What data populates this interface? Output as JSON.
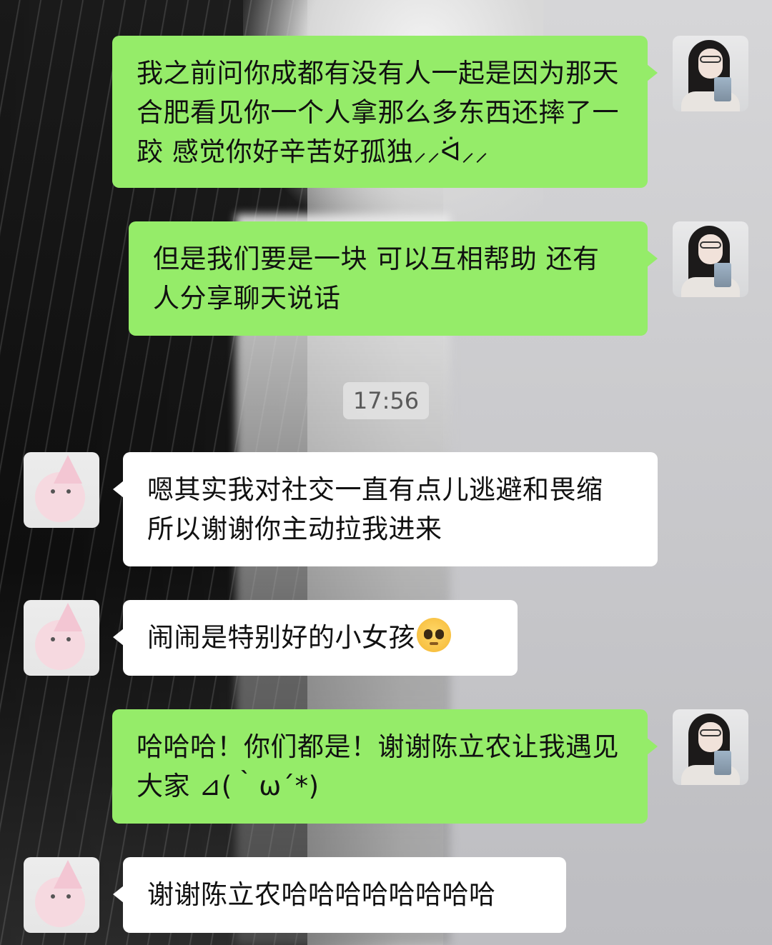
{
  "timestamp": "17:56",
  "messages": [
    {
      "sender": "me",
      "text": "我之前问你成都有没有人一起是因为那天合肥看见你一个人拿那么多东西还摔了一跤 感觉你好辛苦好孤独⸝⸝ᐛ⸝⸝"
    },
    {
      "sender": "me",
      "text": "但是我们要是一块 可以互相帮助 还有人分享聊天说话"
    },
    {
      "sender": "other",
      "text": "嗯其实我对社交一直有点儿逃避和畏缩 所以谢谢你主动拉我进来"
    },
    {
      "sender": "other",
      "text": "闹闹是特别好的小女孩",
      "emoji": "pleading-face"
    },
    {
      "sender": "me",
      "text": "哈哈哈！你们都是！谢谢陈立农让我遇见大家 ⊿(｀ω´*)"
    },
    {
      "sender": "other",
      "text": "谢谢陈立农哈哈哈哈哈哈哈哈"
    }
  ],
  "colors": {
    "me_bubble": "#95ec69",
    "other_bubble": "#ffffff",
    "timestamp_bg": "#e1e1e1"
  },
  "avatars": {
    "me": "girl-with-glasses-avatar",
    "other": "pink-bunny-avatar"
  }
}
